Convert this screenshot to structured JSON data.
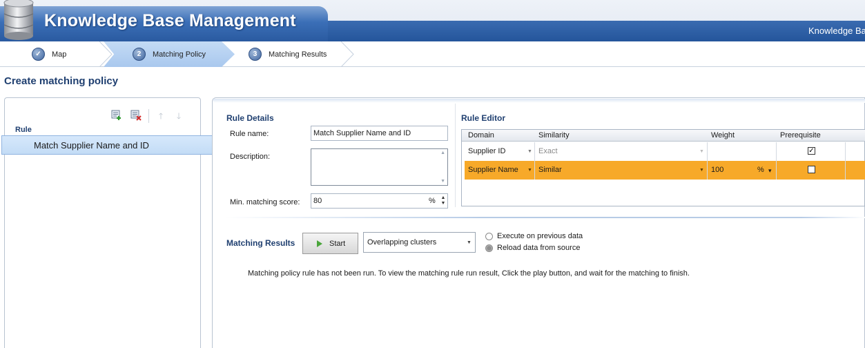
{
  "header": {
    "title": "Knowledge Base Management",
    "right_text": "Knowledge Ba"
  },
  "steps": [
    {
      "num": "✓",
      "label": "Map",
      "state": "done"
    },
    {
      "num": "2",
      "label": "Matching Policy",
      "state": "active"
    },
    {
      "num": "3",
      "label": "Matching Results",
      "state": "pending"
    }
  ],
  "page_title": "Create matching policy",
  "left_panel": {
    "rule_header": "Rule",
    "rules": [
      "Match Supplier Name and ID"
    ],
    "toolbar_icons": [
      "add-rule-icon",
      "delete-rule-icon",
      "move-up-icon",
      "move-down-icon"
    ]
  },
  "rule_details": {
    "title": "Rule Details",
    "name_label": "Rule name:",
    "name_value": "Match Supplier Name and ID",
    "description_label": "Description:",
    "description_value": "",
    "min_score_label": "Min. matching score:",
    "min_score_value": "80",
    "min_score_unit": "%"
  },
  "rule_editor": {
    "title": "Rule Editor",
    "columns": [
      "Domain",
      "Similarity",
      "Weight",
      "Prerequisite"
    ],
    "rows": [
      {
        "domain": "Supplier ID",
        "similarity": "Exact",
        "weight": "",
        "weight_unit": "",
        "prerequisite": true,
        "selected": false
      },
      {
        "domain": "Supplier Name",
        "similarity": "Similar",
        "weight": "100",
        "weight_unit": "%",
        "prerequisite": false,
        "selected": true
      }
    ],
    "selected_row_color": "#f7a929"
  },
  "matching_results": {
    "title": "Matching Results",
    "start_label": "Start",
    "cluster_option": "Overlapping clusters",
    "radio_options": [
      {
        "label": "Execute on previous data",
        "checked": false
      },
      {
        "label": "Reload data from source",
        "checked": true
      }
    ],
    "status_message": "Matching policy rule has not been run. To view the matching rule run result, Click the play button, and wait for the matching to finish."
  },
  "colors": {
    "header_blue": "#2a5aa0",
    "title_navy": "#1f3f70",
    "selection_blue": "#c3dcf6"
  }
}
